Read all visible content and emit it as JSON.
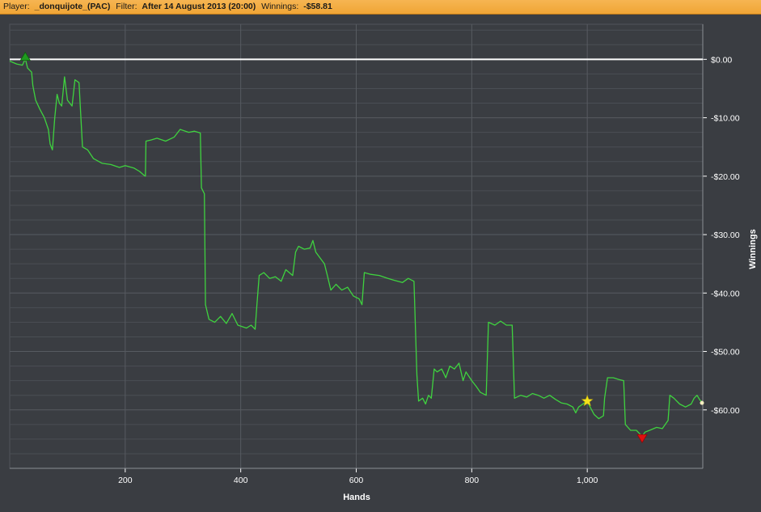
{
  "header": {
    "player_label": "Player:",
    "player_value": "_donquijote_(PAC)",
    "filter_label": "Filter:",
    "filter_value": "After 14 August 2013 (20:00)",
    "winnings_label": "Winnings:",
    "winnings_value": "-$58.81"
  },
  "colors": {
    "header_bg": "#f0a535",
    "plot_bg": "#3a3d42",
    "grid": "#575b61",
    "line": "#3fd23f",
    "zero_line": "#ffffff",
    "max_marker": "#1f9a1f",
    "min_marker": "#e01010",
    "star_marker": "#f5e21c",
    "end_marker": "#f4eec0"
  },
  "chart_data": {
    "type": "line",
    "xlabel": "Hands",
    "ylabel": "Winnings",
    "xlim": [
      0,
      1200
    ],
    "ylim": [
      -70,
      6
    ],
    "x_ticks": [
      200,
      400,
      600,
      800,
      1000
    ],
    "x_tick_labels": [
      "200",
      "400",
      "600",
      "800",
      "1,000"
    ],
    "y_ticks": [
      0,
      -10,
      -20,
      -30,
      -40,
      -50,
      -60
    ],
    "y_tick_labels": [
      "$0.00",
      "-$10.00",
      "-$20.00",
      "-$30.00",
      "-$40.00",
      "-$50.00",
      "-$60.00"
    ],
    "grid": true,
    "zero_line": 0,
    "series": [
      {
        "points": [
          [
            0,
            -0.3
          ],
          [
            12,
            -0.8
          ],
          [
            22,
            -1.0
          ],
          [
            27,
            0.1
          ],
          [
            31,
            -1.5
          ],
          [
            38,
            -2.2
          ],
          [
            40,
            -4.5
          ],
          [
            45,
            -7.0
          ],
          [
            52,
            -8.5
          ],
          [
            60,
            -10.0
          ],
          [
            67,
            -12.0
          ],
          [
            70,
            -14.5
          ],
          [
            74,
            -15.5
          ],
          [
            78,
            -10.0
          ],
          [
            82,
            -6.0
          ],
          [
            86,
            -7.5
          ],
          [
            90,
            -8.0
          ],
          [
            95,
            -3.0
          ],
          [
            100,
            -7.0
          ],
          [
            108,
            -8.0
          ],
          [
            113,
            -3.5
          ],
          [
            120,
            -4.0
          ],
          [
            126,
            -15.0
          ],
          [
            135,
            -15.5
          ],
          [
            145,
            -17.0
          ],
          [
            160,
            -17.8
          ],
          [
            175,
            -18.0
          ],
          [
            190,
            -18.5
          ],
          [
            200,
            -18.2
          ],
          [
            215,
            -18.6
          ],
          [
            225,
            -19.2
          ],
          [
            232,
            -19.8
          ],
          [
            235,
            -20.0
          ],
          [
            236,
            -14.0
          ],
          [
            245,
            -13.8
          ],
          [
            255,
            -13.5
          ],
          [
            270,
            -14.0
          ],
          [
            285,
            -13.3
          ],
          [
            295,
            -12.0
          ],
          [
            310,
            -12.5
          ],
          [
            320,
            -12.3
          ],
          [
            330,
            -12.6
          ],
          [
            332,
            -22.0
          ],
          [
            337,
            -23.0
          ],
          [
            339,
            -42.0
          ],
          [
            345,
            -44.5
          ],
          [
            355,
            -45.0
          ],
          [
            365,
            -44.0
          ],
          [
            375,
            -45.2
          ],
          [
            385,
            -43.5
          ],
          [
            395,
            -45.5
          ],
          [
            410,
            -46.0
          ],
          [
            418,
            -45.5
          ],
          [
            425,
            -46.2
          ],
          [
            428,
            -42.0
          ],
          [
            432,
            -37.0
          ],
          [
            440,
            -36.5
          ],
          [
            450,
            -37.5
          ],
          [
            460,
            -37.2
          ],
          [
            470,
            -38.0
          ],
          [
            478,
            -36.0
          ],
          [
            490,
            -37.0
          ],
          [
            495,
            -33.0
          ],
          [
            500,
            -32.0
          ],
          [
            510,
            -32.5
          ],
          [
            520,
            -32.3
          ],
          [
            525,
            -31.0
          ],
          [
            530,
            -33.0
          ],
          [
            545,
            -35.0
          ],
          [
            550,
            -37.0
          ],
          [
            556,
            -39.5
          ],
          [
            565,
            -38.5
          ],
          [
            575,
            -39.5
          ],
          [
            585,
            -39.0
          ],
          [
            595,
            -40.5
          ],
          [
            605,
            -41.0
          ],
          [
            610,
            -42.0
          ],
          [
            614,
            -36.5
          ],
          [
            625,
            -36.8
          ],
          [
            640,
            -37.0
          ],
          [
            655,
            -37.5
          ],
          [
            665,
            -37.8
          ],
          [
            680,
            -38.2
          ],
          [
            690,
            -37.5
          ],
          [
            700,
            -38.0
          ],
          [
            705,
            -54.0
          ],
          [
            708,
            -58.5
          ],
          [
            715,
            -58.0
          ],
          [
            720,
            -59.0
          ],
          [
            725,
            -57.5
          ],
          [
            730,
            -58.0
          ],
          [
            735,
            -53.0
          ],
          [
            740,
            -53.5
          ],
          [
            748,
            -53.0
          ],
          [
            755,
            -54.5
          ],
          [
            762,
            -52.5
          ],
          [
            770,
            -53.0
          ],
          [
            778,
            -52.0
          ],
          [
            785,
            -55.0
          ],
          [
            790,
            -53.5
          ],
          [
            800,
            -55.0
          ],
          [
            808,
            -56.0
          ],
          [
            815,
            -57.0
          ],
          [
            825,
            -57.5
          ],
          [
            829,
            -45.0
          ],
          [
            840,
            -45.5
          ],
          [
            850,
            -44.8
          ],
          [
            860,
            -45.5
          ],
          [
            870,
            -45.5
          ],
          [
            874,
            -58.0
          ],
          [
            885,
            -57.5
          ],
          [
            895,
            -57.8
          ],
          [
            905,
            -57.2
          ],
          [
            915,
            -57.5
          ],
          [
            925,
            -58.0
          ],
          [
            935,
            -57.5
          ],
          [
            945,
            -58.2
          ],
          [
            955,
            -58.8
          ],
          [
            965,
            -59.0
          ],
          [
            975,
            -59.5
          ],
          [
            980,
            -60.5
          ],
          [
            985,
            -59.5
          ],
          [
            995,
            -58.8
          ],
          [
            1000,
            -58.5
          ],
          [
            1005,
            -59.5
          ],
          [
            1012,
            -60.8
          ],
          [
            1020,
            -61.5
          ],
          [
            1028,
            -61.0
          ],
          [
            1030,
            -58.0
          ],
          [
            1035,
            -54.5
          ],
          [
            1045,
            -54.5
          ],
          [
            1055,
            -54.8
          ],
          [
            1063,
            -55.0
          ],
          [
            1066,
            -62.5
          ],
          [
            1075,
            -63.5
          ],
          [
            1085,
            -63.5
          ],
          [
            1095,
            -64.5
          ],
          [
            1100,
            -63.8
          ],
          [
            1108,
            -63.5
          ],
          [
            1120,
            -63.0
          ],
          [
            1130,
            -63.2
          ],
          [
            1140,
            -61.8
          ],
          [
            1143,
            -57.5
          ],
          [
            1150,
            -58.0
          ],
          [
            1160,
            -59.0
          ],
          [
            1170,
            -59.5
          ],
          [
            1180,
            -59.0
          ],
          [
            1185,
            -58.0
          ],
          [
            1190,
            -57.5
          ],
          [
            1195,
            -58.3
          ],
          [
            1200,
            -58.81
          ]
        ]
      }
    ],
    "markers": [
      {
        "type": "max",
        "shape": "triangle-up",
        "x": 27,
        "y": 0.1
      },
      {
        "type": "star",
        "shape": "star",
        "x": 1000,
        "y": -58.5
      },
      {
        "type": "min",
        "shape": "triangle-down",
        "x": 1095,
        "y": -64.5
      },
      {
        "type": "end",
        "shape": "dot",
        "x": 1200,
        "y": -58.81
      }
    ]
  }
}
